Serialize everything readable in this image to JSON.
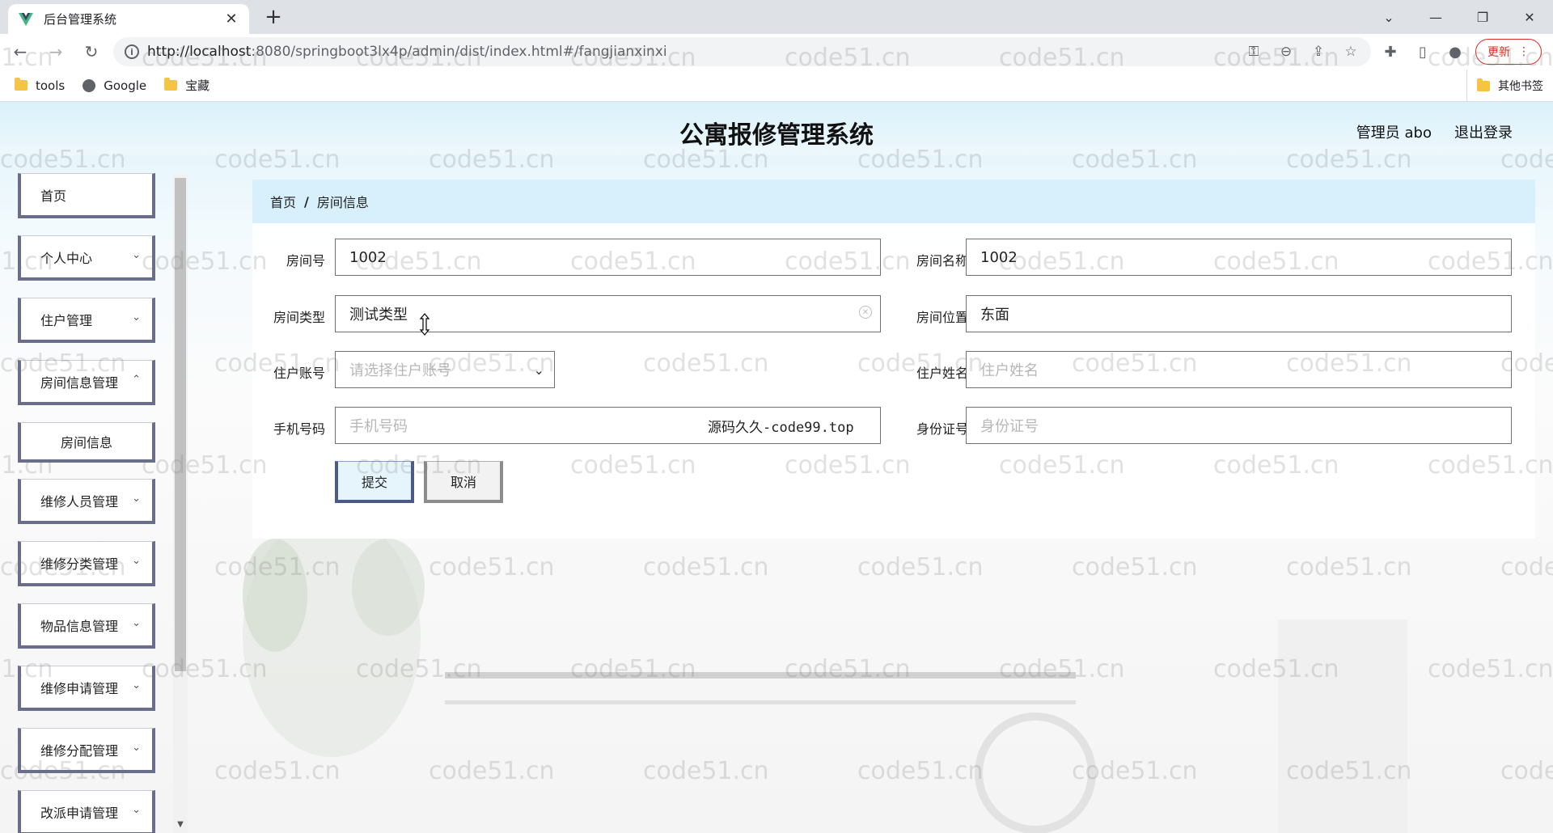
{
  "browser": {
    "tab_title": "后台管理系统",
    "tab_close": "✕",
    "new_tab": "+",
    "url_host": "http://localhost",
    "url_rest": ":8080/springboot3lx4p/admin/dist/index.html#/fangjianxinxi",
    "update_label": "更新",
    "bookmarks": [
      "tools",
      "Google",
      "宝藏"
    ],
    "other_bookmarks": "其他书签"
  },
  "app": {
    "title": "公寓报修管理系统",
    "user": "管理员 abo",
    "logout": "退出登录"
  },
  "sidebar": {
    "items": [
      {
        "label": "首页"
      },
      {
        "label": "个人中心"
      },
      {
        "label": "住户管理"
      },
      {
        "label": "房间信息管理"
      },
      {
        "label": "房间信息"
      },
      {
        "label": "维修人员管理"
      },
      {
        "label": "维修分类管理"
      },
      {
        "label": "物品信息管理"
      },
      {
        "label": "维修申请管理"
      },
      {
        "label": "维修分配管理"
      },
      {
        "label": "改派申请管理"
      }
    ]
  },
  "breadcrumb": {
    "home": "首页",
    "separator": "/",
    "current": "房间信息"
  },
  "form": {
    "room_no_label": "房间号",
    "room_no_value": "1002",
    "room_name_label": "房间名称",
    "room_name_value": "1002",
    "room_type_label": "房间类型",
    "room_type_value": "测试类型",
    "room_location_label": "房间位置",
    "room_location_value": "东面",
    "resident_account_label": "住户账号",
    "resident_account_placeholder": "请选择住户账号",
    "resident_name_label": "住户姓名",
    "resident_name_placeholder": "住户姓名",
    "phone_label": "手机号码",
    "phone_placeholder": "手机号码",
    "id_card_label": "身份证号",
    "id_card_placeholder": "身份证号",
    "submit": "提交",
    "cancel": "取消"
  },
  "overlay_text": "源码久久-code99.top",
  "watermark": "code51.cn"
}
